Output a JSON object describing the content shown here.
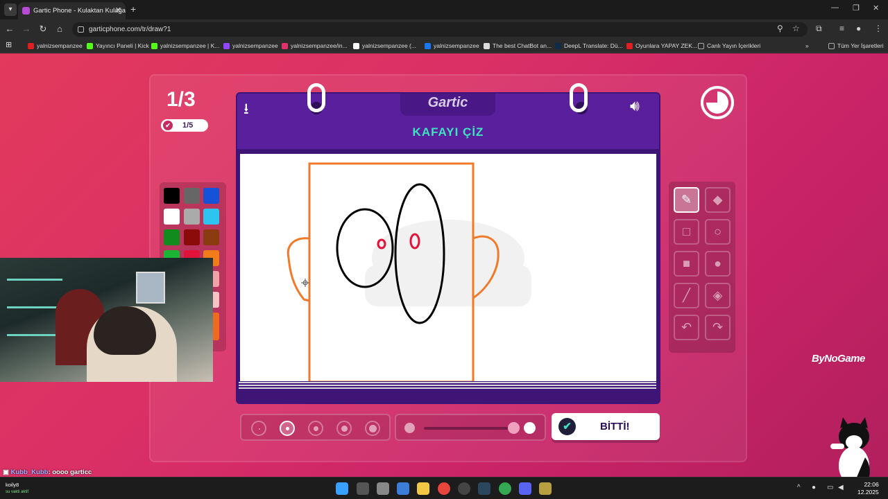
{
  "browser": {
    "tab_title": "Gartic Phone - Kulaktan Kulağa",
    "tab_close": "✕",
    "new_tab": "+",
    "url": "garticphone.com/tr/draw?1",
    "window_controls": [
      "—",
      "❐",
      "✕"
    ],
    "bookmarks": [
      {
        "label": "yalnizsempanzee",
        "color": "#e02020"
      },
      {
        "label": "Yayıncı Paneli | Kick",
        "color": "#53fc18"
      },
      {
        "label": "yalnizsempanzee | K...",
        "color": "#53fc18"
      },
      {
        "label": "yalnizsempanzee",
        "color": "#9146ff"
      },
      {
        "label": "yalnizsempanzee/in...",
        "color": "#e1306c"
      },
      {
        "label": "yalnizsempanzee (...",
        "color": "#ffffff"
      },
      {
        "label": "yalnizsempanzee",
        "color": "#1877f2"
      },
      {
        "label": "The best ChatBot an...",
        "color": "#dddddd"
      },
      {
        "label": "DeepL Translate: Dü...",
        "color": "#0f2b46"
      },
      {
        "label": "Oyunlara YAPAY ZEK...",
        "color": "#e02020"
      },
      {
        "label": "Canlı Yayın İçerikleri",
        "color": "#aaaaaa"
      }
    ],
    "all_bookmarks": "Tüm Yer İşaretleri",
    "more_bookmarks": "»"
  },
  "game": {
    "round": "1/3",
    "progress": "1/5",
    "logo": "Gartic",
    "prompt": "KAFAYI ÇİZ",
    "done_label": "BİTTİ!",
    "palette": [
      "#000000",
      "#666666",
      "#1652d8",
      "#ffffff",
      "#aaaaaa",
      "#2ec4f2",
      "#118a1e",
      "#8b0a0a",
      "#8a3c10",
      "#1cb434",
      "#e2133a",
      "#f27c1a"
    ],
    "selected_color": "#f27c1a",
    "tools": [
      "pencil-icon",
      "eraser-icon",
      "rectangle-icon",
      "ellipse-icon",
      "filled-rectangle-icon",
      "filled-ellipse-icon",
      "line-icon",
      "fill-bucket-icon",
      "undo-icon",
      "redo-icon"
    ],
    "active_tool": "pencil-icon",
    "brush_size_selected_index": 1,
    "opacity_level": 0.95
  },
  "overlay": {
    "sponsor": "ByNoGame",
    "chat_user": "Kubb_Kubb",
    "chat_message": ": oooo garticc"
  },
  "taskbar": {
    "user": "koily8",
    "user_status": "su vakti aktif",
    "time": "22:06",
    "date": "12.2025"
  },
  "colors": {
    "sketch_header": "#5a1f9c",
    "prompt_color": "#3fe3c0",
    "background": "#d92f67"
  }
}
